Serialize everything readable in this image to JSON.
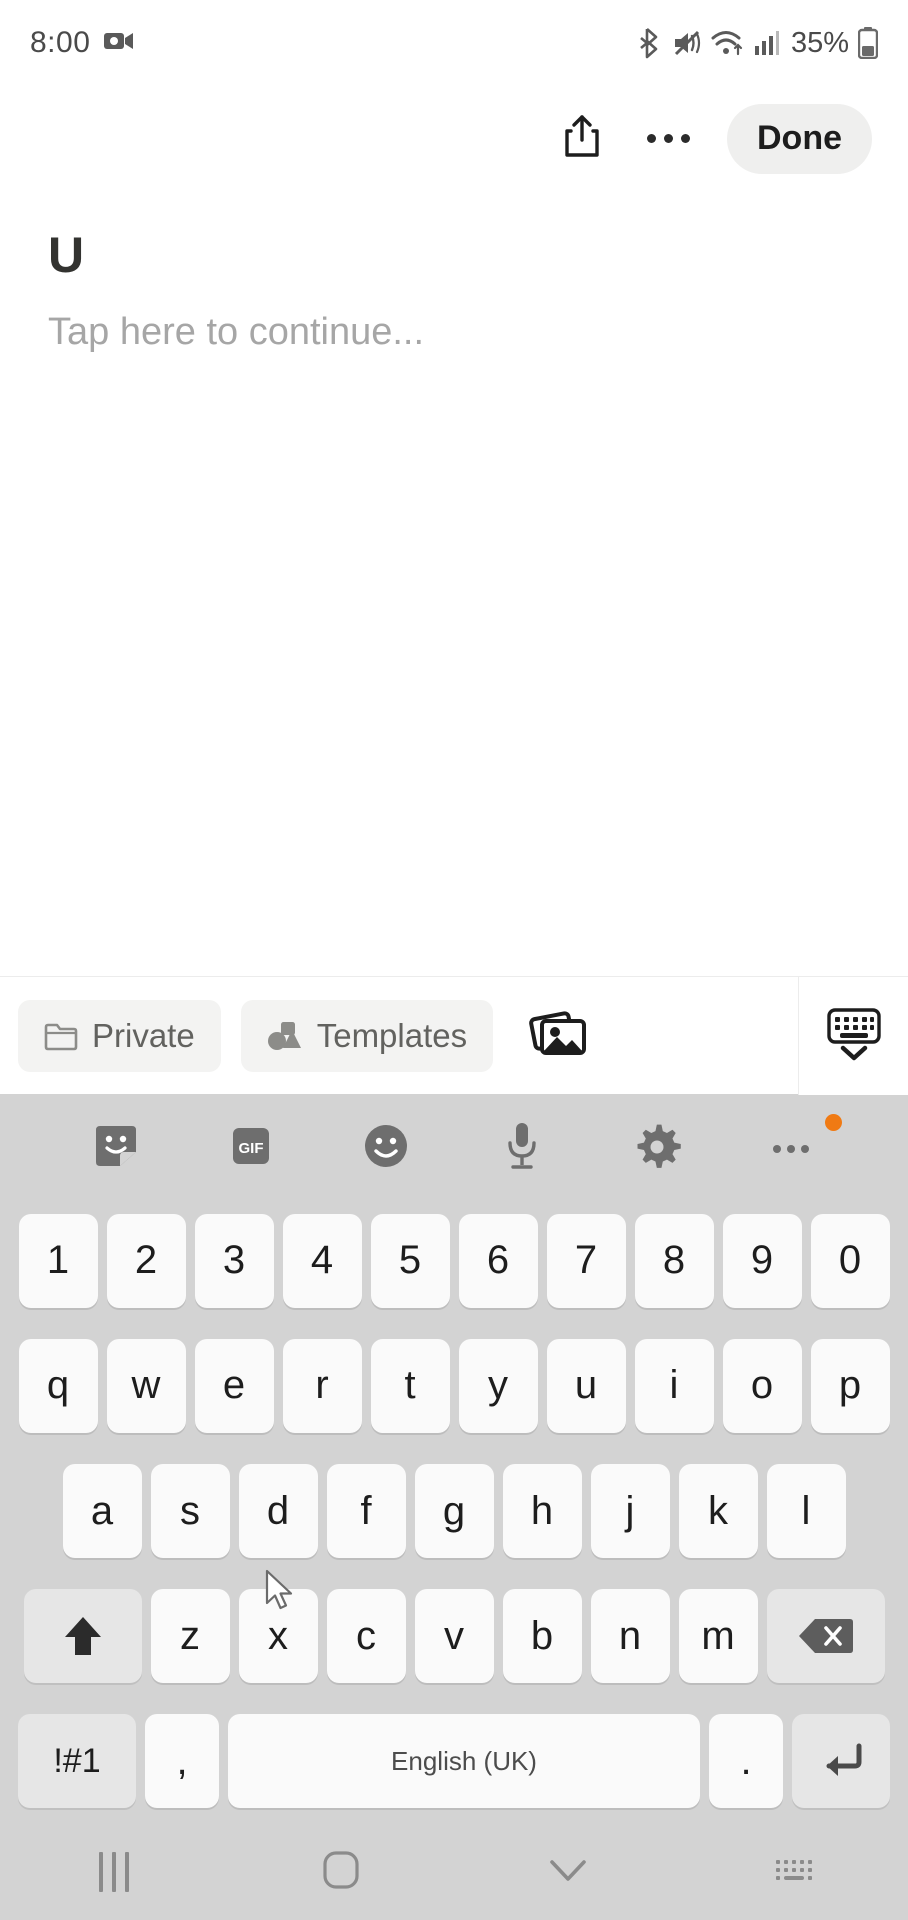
{
  "status_bar": {
    "time": "8:00",
    "battery_percent": "35%",
    "icons": [
      "video-camera-icon",
      "bluetooth-icon",
      "mute-vibrate-icon",
      "wifi-icon",
      "cellular-signal-icon",
      "battery-icon"
    ]
  },
  "app_bar": {
    "share_icon": "share-icon",
    "more_icon": "more-options-icon",
    "done_label": "Done"
  },
  "note": {
    "title": "U",
    "placeholder": "Tap here to continue..."
  },
  "chip_bar": {
    "private_label": "Private",
    "private_icon": "folder-icon",
    "templates_label": "Templates",
    "templates_icon": "shapes-icon",
    "gallery_icon": "gallery-icon",
    "keyboard_toggle_icon": "keyboard-hide-icon"
  },
  "keyboard": {
    "toolbar_icons": [
      "sticker-icon",
      "gif-icon",
      "emoji-icon",
      "microphone-icon",
      "settings-gear-icon",
      "more-dots-icon"
    ],
    "gif_label": "GIF",
    "rows": {
      "numbers": [
        "1",
        "2",
        "3",
        "4",
        "5",
        "6",
        "7",
        "8",
        "9",
        "0"
      ],
      "top": [
        "q",
        "w",
        "e",
        "r",
        "t",
        "y",
        "u",
        "i",
        "o",
        "p"
      ],
      "home": [
        "a",
        "s",
        "d",
        "f",
        "g",
        "h",
        "j",
        "k",
        "l"
      ],
      "bottom": [
        "z",
        "x",
        "c",
        "v",
        "b",
        "n",
        "m"
      ]
    },
    "shift_icon": "shift-icon",
    "backspace_icon": "backspace-icon",
    "symbols_label": "!#1",
    "comma_label": ",",
    "space_label": "English (UK)",
    "period_label": ".",
    "enter_icon": "enter-icon"
  },
  "nav_bar": {
    "recents_icon": "recents-icon",
    "home_icon": "home-icon",
    "back_icon": "hide-keyboard-chevron-icon",
    "keyboard_switch_icon": "keyboard-switch-icon"
  },
  "colors": {
    "accent_badge": "#f07a13",
    "keyboard_bg": "#d3d3d3",
    "key_bg": "#fafafa",
    "key_fn_bg": "#e6e6e6",
    "done_bg": "#efefee",
    "chip_bg": "#f3f3f2",
    "placeholder_text": "#a6a6a6",
    "title_text": "#333330"
  }
}
